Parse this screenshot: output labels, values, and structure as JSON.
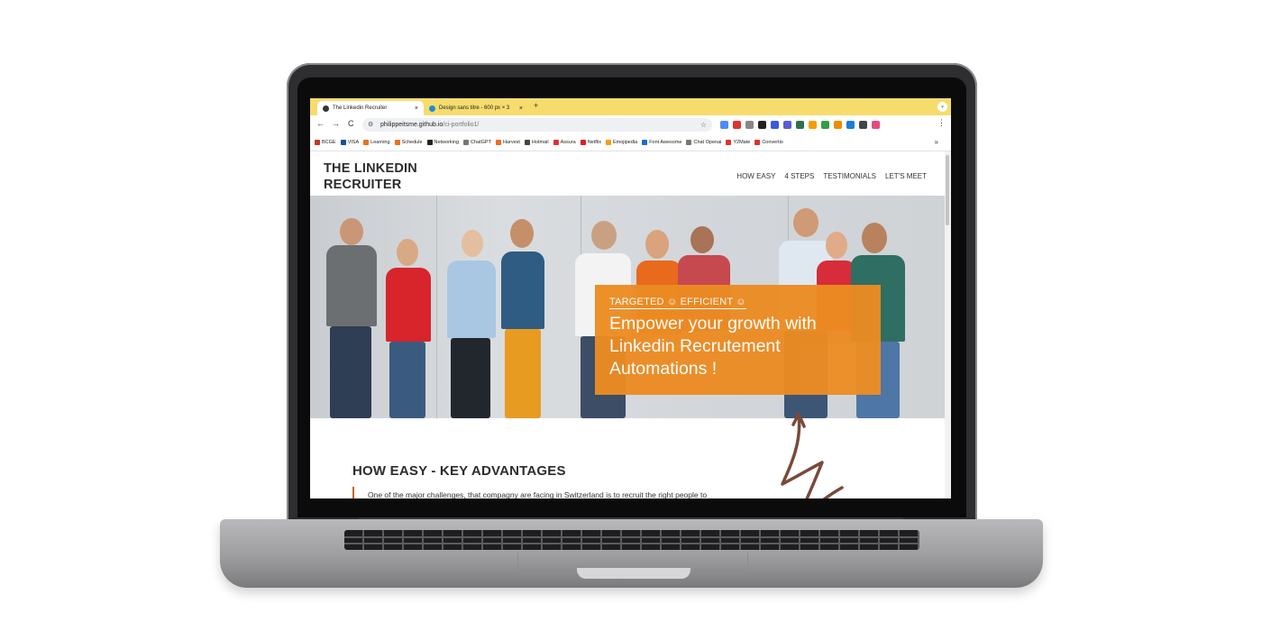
{
  "browser": {
    "tabs": [
      {
        "title": "The Linkedin Recruiter",
        "icon": "globe-icon",
        "active": true
      },
      {
        "title": "Design sans titre - 600 px × 3",
        "icon": "canva-icon",
        "active": false
      }
    ],
    "new_tab": "+",
    "tab_close": "×",
    "tab_menu": "⌄",
    "address": {
      "host": "philippeitsme.github.io",
      "path": "/ci-portfolio1/"
    },
    "nav": {
      "back": "←",
      "forward": "→",
      "reload": "C"
    },
    "bookmarks": [
      {
        "label": "BCGE",
        "color": "#c0392b"
      },
      {
        "label": "VISA",
        "color": "#1a4f9c"
      },
      {
        "label": "Learning",
        "color": "#e8731c"
      },
      {
        "label": "Schedule",
        "color": "#e8731c"
      },
      {
        "label": "Networking",
        "color": "#222222"
      },
      {
        "label": "ChatGPT",
        "color": "#777777"
      },
      {
        "label": "Harvest",
        "color": "#f36c21"
      },
      {
        "label": "Hotmail",
        "color": "#444444"
      },
      {
        "label": "Assura",
        "color": "#e03131"
      },
      {
        "label": "Netflix",
        "color": "#d81f26"
      },
      {
        "label": "Emojipedia",
        "color": "#f59f00"
      },
      {
        "label": "Font Awesome",
        "color": "#1971c2"
      },
      {
        "label": "Chat Openai",
        "color": "#777777"
      },
      {
        "label": "Y2Mate",
        "color": "#e03131"
      },
      {
        "label": "Convertio",
        "color": "#e03131"
      }
    ],
    "bookmarks_more": "»",
    "extension_colors": [
      "#4c8df6",
      "#d33",
      "#888",
      "#222",
      "#3b5bdb",
      "#5b5bd6",
      "#2f6f4e",
      "#f59f00",
      "#2f9e44",
      "#f08c00",
      "#1c7ed6",
      "#444",
      "#e64980"
    ]
  },
  "site": {
    "brand": "THE LINKEDIN RECRUITER",
    "nav": [
      "HOW EASY",
      "4 STEPS",
      "TESTIMONIALS",
      "LET'S MEET"
    ],
    "hero": {
      "tagline": "TARGETED ☺ EFFICIENT ☺",
      "headline": "Empower your growth with Linkedin Recrutement Automations !",
      "banner_color": "#ec8c22"
    },
    "section": {
      "title": "HOW EASY - KEY ADVANTAGES",
      "text": "One of the major challenges, that compagny are facing in Switzerland is to recruit the right people to"
    },
    "accent_color": "#c9611d"
  }
}
